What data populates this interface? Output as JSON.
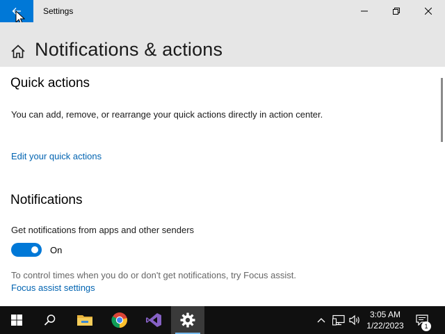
{
  "window": {
    "title": "Settings",
    "controls": [
      "minimize",
      "maximize",
      "close"
    ]
  },
  "header": {
    "title": "Notifications & actions"
  },
  "quick_actions": {
    "heading": "Quick actions",
    "description": "You can add, remove, or rearrange your quick actions directly in action center.",
    "link": "Edit your quick actions"
  },
  "notifications": {
    "heading": "Notifications",
    "toggle_label": "Get notifications from apps and other senders",
    "toggle_state": "On",
    "toggle_on": true,
    "focus_text": "To control times when you do or don't get notifications, try Focus assist.",
    "focus_link": "Focus assist settings"
  },
  "taskbar": {
    "apps": [
      "start-icon",
      "search-icon",
      "file-explorer-icon",
      "chrome-icon",
      "visual-studio-icon",
      "settings-icon"
    ],
    "active_app": "settings-icon",
    "time": "3:05 AM",
    "date": "1/22/2023",
    "notification_count": "1"
  },
  "colors": {
    "accent": "#0078d7",
    "link": "#0063b1",
    "titlebar": "#e6e6e6",
    "taskbar": "#101010"
  }
}
